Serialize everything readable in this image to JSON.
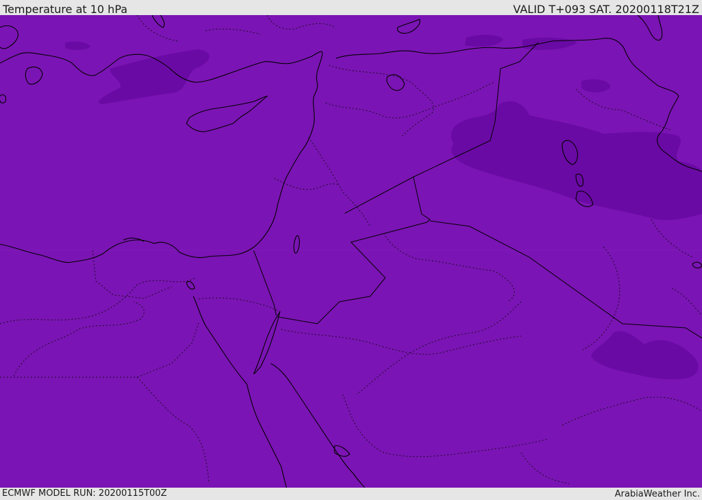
{
  "header": {
    "title": "Temperature at 10 hPa",
    "valid_time": "VALID T+093 SAT. 20200118T21Z"
  },
  "footer": {
    "model_run": "ECMWF MODEL RUN: 20200115T00Z",
    "credit": "ArabiaWeather Inc."
  },
  "map": {
    "field_color": "#7b14b4",
    "colder_patch_color": "#6a0aa4",
    "coastline_color": "#000000",
    "border_style": "dotted"
  }
}
